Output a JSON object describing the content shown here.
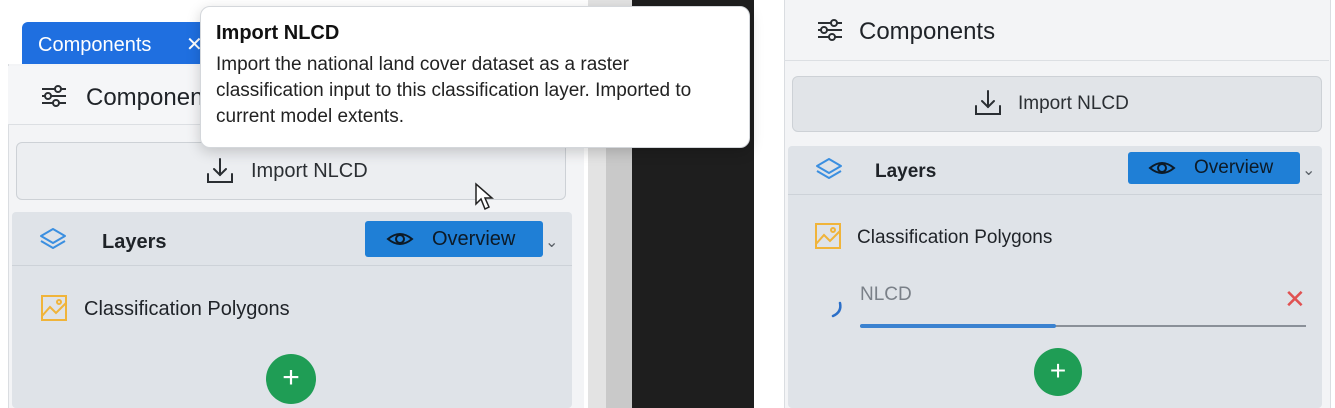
{
  "tab": {
    "label": "Components",
    "close": "✕"
  },
  "left_panel": {
    "title": "Components",
    "import_button": "Import NLCD",
    "layers": {
      "label": "Layers",
      "overview": "Overview"
    },
    "polygon_item": "Classification Polygons",
    "add_button": "+"
  },
  "tooltip": {
    "title": "Import NLCD",
    "body": "Import the national land cover dataset as a raster classification input to this classification layer. Imported to current model extents."
  },
  "right_panel": {
    "title": "Components",
    "import_button": "Import NLCD",
    "layers": {
      "label": "Layers",
      "overview": "Overview"
    },
    "polygon_item": "Classification Polygons",
    "nlcd_item": {
      "label": "NLCD",
      "remove": "✕",
      "progress": 0.44
    },
    "add_button": "+"
  },
  "colors": {
    "accent": "#1f7fd6",
    "add": "#1f9d55",
    "remove": "#e05252",
    "tab": "#1f6fe0"
  },
  "icons": [
    "sliders-icon",
    "download-icon",
    "layers-icon",
    "eye-icon",
    "chevron-down-icon",
    "image-icon",
    "plus-icon",
    "close-icon",
    "spinner-icon",
    "cursor-icon"
  ]
}
